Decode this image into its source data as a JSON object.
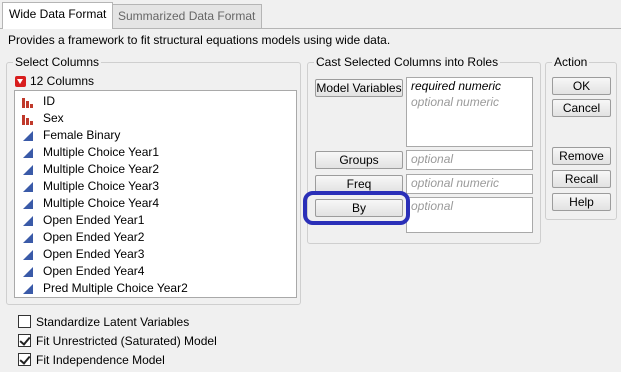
{
  "tabs": [
    {
      "label": "Wide Data Format",
      "active": true
    },
    {
      "label": "Summarized Data Format",
      "active": false
    }
  ],
  "description": "Provides a framework to fit structural equations models using wide data.",
  "select_columns": {
    "title": "Select Columns",
    "count_label": "12 Columns",
    "columns": [
      {
        "label": "ID",
        "icon": "nominal-bar-icon"
      },
      {
        "label": "Sex",
        "icon": "nominal-bar-icon"
      },
      {
        "label": "Female Binary",
        "icon": "continuous-triangle-icon"
      },
      {
        "label": "Multiple Choice Year1",
        "icon": "continuous-triangle-icon"
      },
      {
        "label": "Multiple Choice Year2",
        "icon": "continuous-triangle-icon"
      },
      {
        "label": "Multiple Choice Year3",
        "icon": "continuous-triangle-icon"
      },
      {
        "label": "Multiple Choice Year4",
        "icon": "continuous-triangle-icon"
      },
      {
        "label": "Open Ended Year1",
        "icon": "continuous-triangle-icon"
      },
      {
        "label": "Open Ended Year2",
        "icon": "continuous-triangle-icon"
      },
      {
        "label": "Open Ended Year3",
        "icon": "continuous-triangle-icon"
      },
      {
        "label": "Open Ended Year4",
        "icon": "continuous-triangle-icon"
      },
      {
        "label": "Pred Multiple Choice Year2",
        "icon": "continuous-triangle-icon"
      }
    ]
  },
  "cast_roles": {
    "title": "Cast Selected Columns into Roles",
    "model_variables": {
      "button": "Model Variables",
      "line1": "required numeric",
      "line2": "optional numeric"
    },
    "groups": {
      "button": "Groups",
      "placeholder": "optional"
    },
    "freq": {
      "button": "Freq",
      "placeholder": "optional numeric"
    },
    "by": {
      "button": "By",
      "placeholder": "optional"
    }
  },
  "action": {
    "title": "Action",
    "ok": "OK",
    "cancel": "Cancel",
    "remove": "Remove",
    "recall": "Recall",
    "help": "Help"
  },
  "options": [
    {
      "label": "Standardize Latent Variables",
      "checked": false
    },
    {
      "label": "Fit Unrestricted (Saturated) Model",
      "checked": true
    },
    {
      "label": "Fit Independence Model",
      "checked": true
    }
  ],
  "colors": {
    "nominal_icon": "#c0392b",
    "continuous_icon": "#3a5aa8",
    "dropdown_icon": "#d81e1e",
    "highlight": "#2a2fb8"
  }
}
